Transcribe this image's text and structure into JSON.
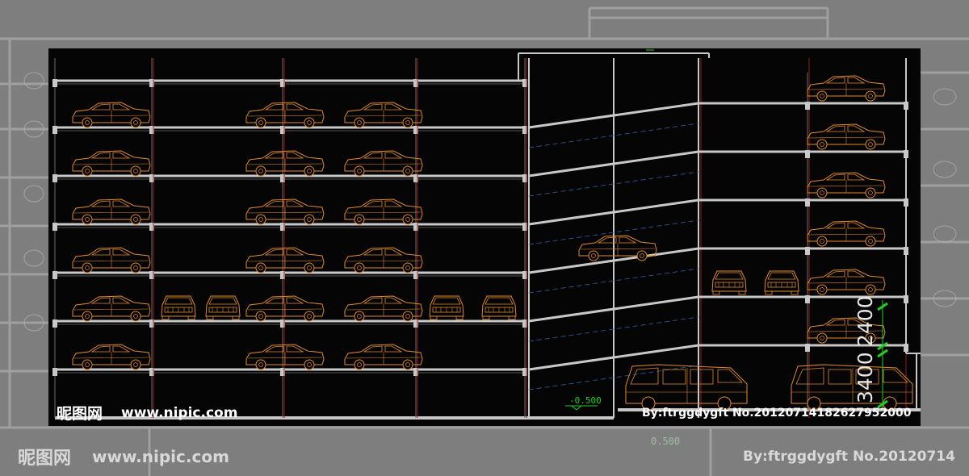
{
  "drawing": {
    "background": "#050505",
    "slab_color": "#c8c8c8",
    "car_color": "#e08a28",
    "column_color": "#8c1c1c",
    "ramp_dash_color": "#2a4f8a",
    "dimension_color": "#20d020",
    "elevation_label": "-0.500",
    "dimension_upper": "2400",
    "dimension_lower": "3400",
    "icons": [
      "sedan-icon",
      "hatchback-front-icon",
      "van-icon"
    ]
  },
  "watermark": {
    "logo": "昵图网",
    "url": "www.nipic.com",
    "author_full": "By:ftrggdygft  No.20120714182627952000",
    "author_cropped": "By:ftrggdygft  No.20120714"
  },
  "background_sheet": {
    "elevation_label": "0.500"
  }
}
